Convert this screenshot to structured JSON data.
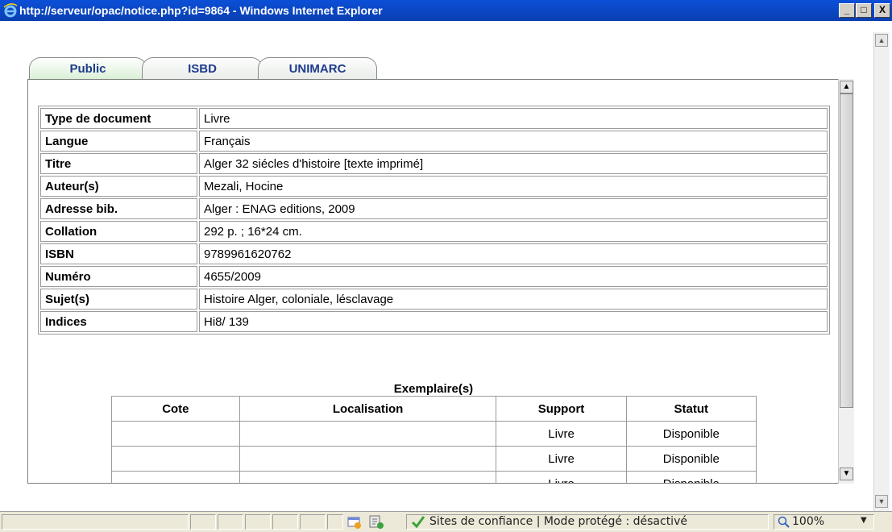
{
  "window": {
    "title": "http://serveur/opac/notice.php?id=9864 - Windows Internet Explorer",
    "min_glyph": "_",
    "max_glyph": "□",
    "close_glyph": "X"
  },
  "tabs": [
    {
      "label": "Public",
      "active": true
    },
    {
      "label": "ISBD",
      "active": false
    },
    {
      "label": "UNIMARC",
      "active": false
    }
  ],
  "notice": {
    "rows": [
      {
        "label": "Type de document",
        "value": "Livre"
      },
      {
        "label": "Langue",
        "value": "Français"
      },
      {
        "label": "Titre",
        "value": "Alger 32 siécles d'histoire [texte imprimé]"
      },
      {
        "label": "Auteur(s)",
        "value": "Mezali, Hocine"
      },
      {
        "label": "Adresse bib.",
        "value": "Alger : ENAG editions, 2009"
      },
      {
        "label": "Collation",
        "value": "292 p. ; 16*24 cm."
      },
      {
        "label": "ISBN",
        "value": "9789961620762"
      },
      {
        "label": "Numéro",
        "value": "4655/2009"
      },
      {
        "label": "Sujet(s)",
        "value": "Histoire Alger, coloniale, lésclavage"
      },
      {
        "label": "Indices",
        "value": "Hi8/ 139"
      }
    ]
  },
  "exemplaires": {
    "title": "Exemplaire(s)",
    "headers": [
      "Cote",
      "Localisation",
      "Support",
      "Statut"
    ],
    "rows": [
      [
        "",
        "",
        "Livre",
        "Disponible"
      ],
      [
        "",
        "",
        "Livre",
        "Disponible"
      ],
      [
        "",
        "",
        "Livre",
        "Disponible"
      ]
    ]
  },
  "statusbar": {
    "zone_text": "Sites de confiance | Mode protégé : désactivé",
    "zoom": "100%"
  },
  "colors": {
    "titlebar": "#0a3fb0",
    "tab_text": "#1d3b8c",
    "trusted_check": "#3aa43a"
  }
}
